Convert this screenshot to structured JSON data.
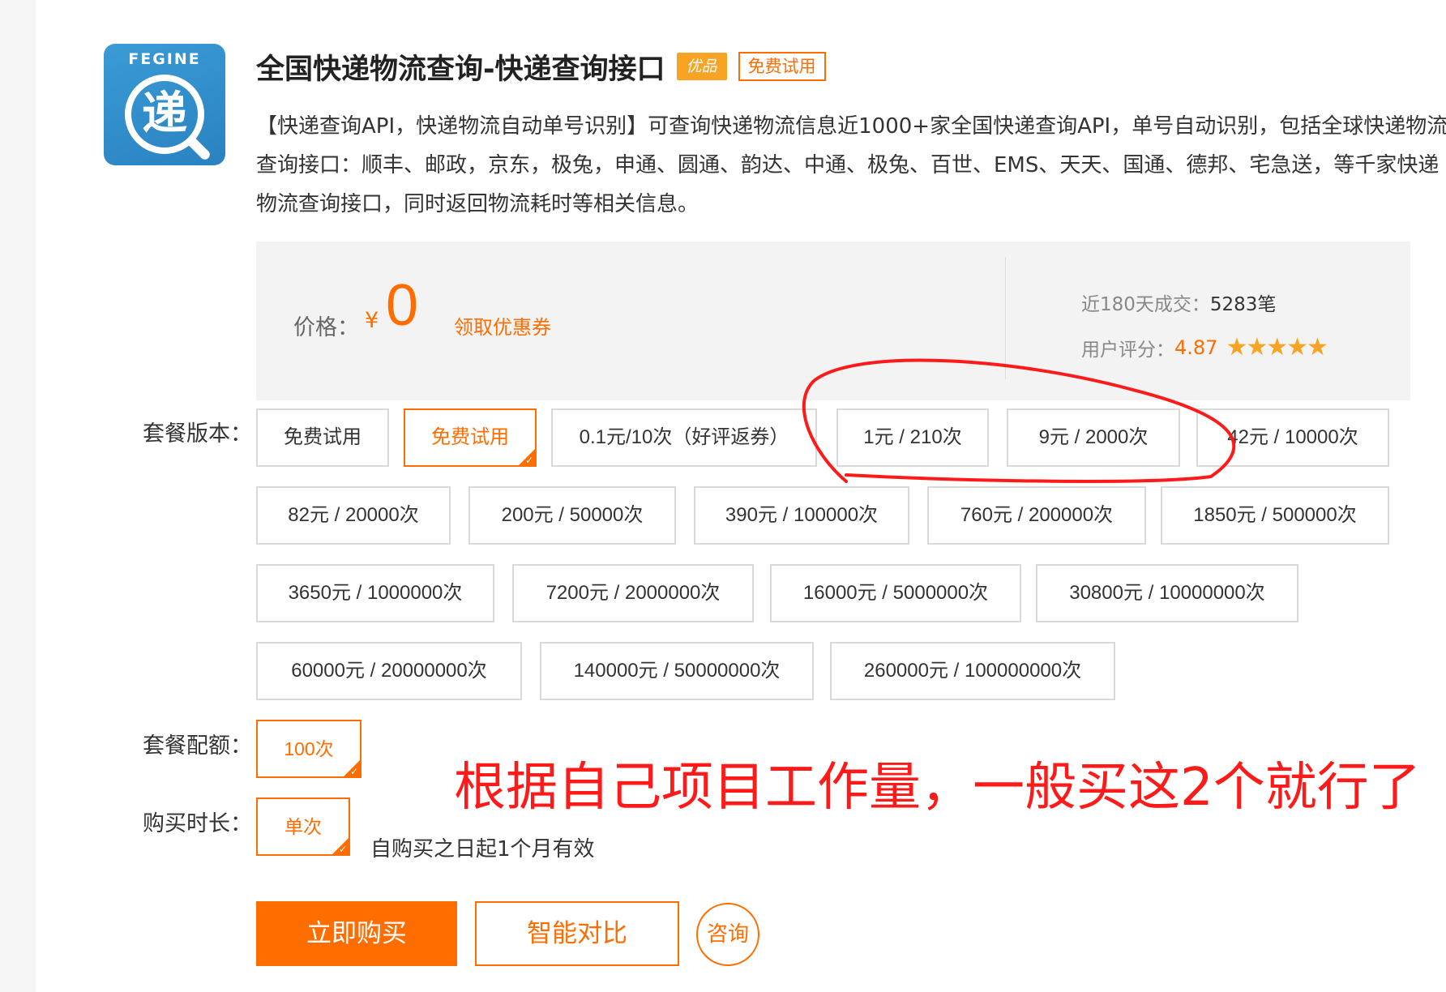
{
  "app": {
    "logo_brand": "FEGINE",
    "logo_char": "递",
    "title": "全国快递物流查询-快递查询接口",
    "tag_quality": "优品",
    "tag_trial": "免费试用",
    "description": "【快递查询API，快递物流自动单号识别】可查询快递物流信息近1000+家全国快递查询API，单号自动识别，包括全球快递物流查询接口：顺丰、邮政，京东，极兔，申通、圆通、韵达、中通、极兔、百世、EMS、天天、国通、德邦、宅急送，等千家快递物流查询接口，同时返回物流耗时等相关信息。"
  },
  "price": {
    "label": "价格：",
    "currency": "¥",
    "value": "0",
    "coupon": "领取优惠券",
    "sales_label": "近180天成交：",
    "sales_value": "5283笔",
    "rating_label": "用户评分：",
    "rating_value": "4.87",
    "stars": "★★★★★"
  },
  "packages": {
    "label": "套餐版本：",
    "options": [
      "免费试用",
      "免费试用",
      "0.1元/10次（好评返券）",
      "1元 / 210次",
      "9元 / 2000次",
      "42元 / 10000次",
      "82元 / 20000次",
      "200元 / 50000次",
      "390元 / 100000次",
      "760元 / 200000次",
      "1850元 / 500000次",
      "3650元 / 1000000次",
      "7200元 / 2000000次",
      "16000元 / 5000000次",
      "30800元 / 10000000次",
      "60000元 / 20000000次",
      "140000元 / 50000000次",
      "260000元 / 100000000次"
    ],
    "selected_index": 1
  },
  "quota": {
    "label": "套餐配额：",
    "value": "100次"
  },
  "duration": {
    "label": "购买时长：",
    "value": "单次",
    "note": "自购买之日起1个月有效"
  },
  "actions": {
    "buy": "立即购买",
    "compare": "智能对比",
    "consult": "咨询"
  },
  "annotation": {
    "text": "根据自己项目工作量，一般买这2个就行了",
    "color": "#ff1a1a"
  },
  "colors": {
    "accent": "#ff6d00",
    "star": "#f7a425"
  }
}
